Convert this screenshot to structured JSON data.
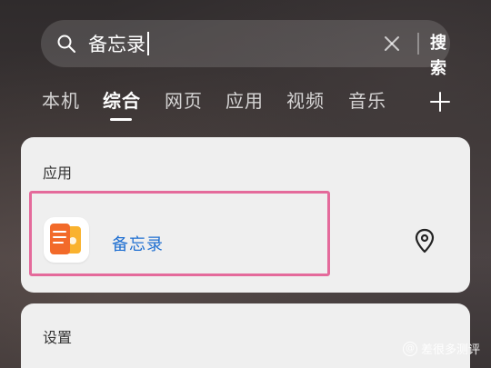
{
  "search": {
    "query": "备忘录",
    "button_label": "搜索"
  },
  "tabs": [
    {
      "label": "本机",
      "active": false
    },
    {
      "label": "综合",
      "active": true
    },
    {
      "label": "网页",
      "active": false
    },
    {
      "label": "应用",
      "active": false
    },
    {
      "label": "视频",
      "active": false
    },
    {
      "label": "音乐",
      "active": false
    }
  ],
  "apps_section": {
    "title": "应用",
    "result": {
      "name": "备忘录",
      "icon": "notes-app-icon",
      "action_icon": "location-pin-icon"
    }
  },
  "settings_section": {
    "title": "设置"
  },
  "watermark": {
    "text": "差很多测评"
  },
  "colors": {
    "accent": "#1f6fd1",
    "highlight": "#e46a9b",
    "card_bg": "#efefef"
  }
}
